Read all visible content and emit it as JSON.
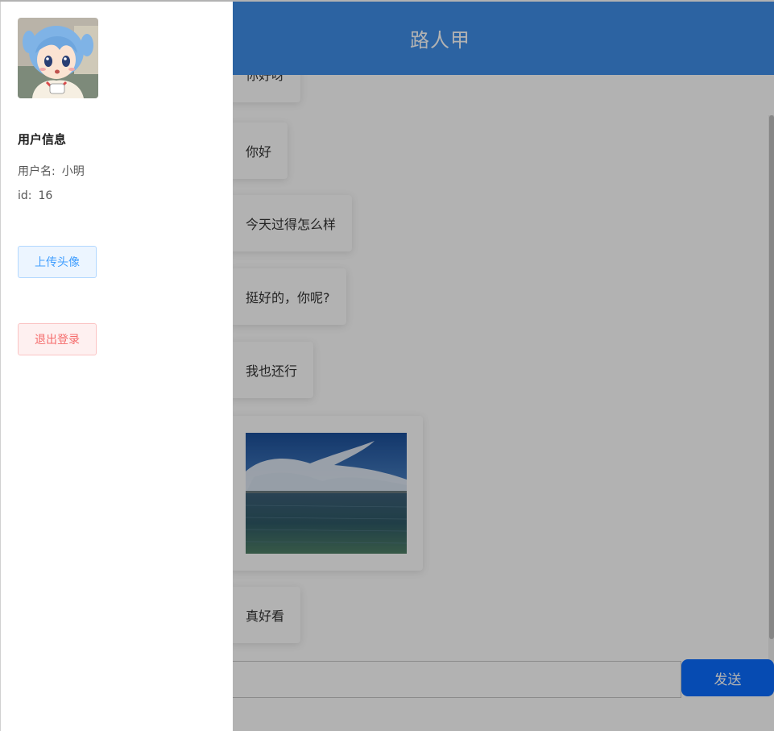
{
  "chat": {
    "title": "路人甲",
    "messages": [
      {
        "type": "text",
        "text": "你好呀"
      },
      {
        "type": "text",
        "text": "你好"
      },
      {
        "type": "text",
        "text": "今天过得怎么样"
      },
      {
        "type": "text",
        "text": "挺好的，你呢?"
      },
      {
        "type": "text",
        "text": "我也还行"
      },
      {
        "type": "image"
      },
      {
        "type": "text",
        "text": "真好看"
      }
    ],
    "input_value": "",
    "send_label": "发送"
  },
  "drawer": {
    "section_title": "用户信息",
    "username_label": "用户名:",
    "username_value": "小明",
    "id_label": "id:",
    "id_value": "16",
    "upload_label": "上传头像",
    "logout_label": "退出登录"
  },
  "colors": {
    "header_bg": "#3f8fe8",
    "send_bg": "#0a6cff",
    "upload_text": "#409eff",
    "logout_text": "#f56c6c"
  },
  "icons": [
    "avatar-image",
    "lake-sky-photo"
  ]
}
